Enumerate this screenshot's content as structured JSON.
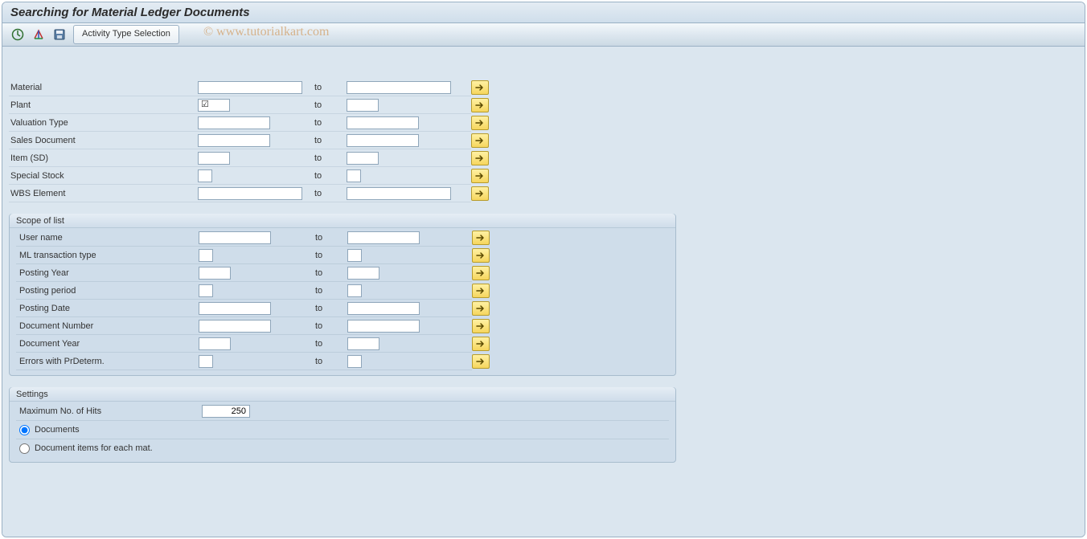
{
  "title": "Searching for Material Ledger Documents",
  "toolbar": {
    "activity_btn": "Activity Type Selection"
  },
  "watermark": "© www.tutorialkart.com",
  "to_label": "to",
  "top_fields": [
    {
      "label": "Material",
      "from_w": "lg",
      "to_w": "lg",
      "check": false
    },
    {
      "label": "Plant",
      "from_w": "sm",
      "to_w": "sm",
      "check": true
    },
    {
      "label": "Valuation Type",
      "from_w": "md",
      "to_w": "md",
      "check": false
    },
    {
      "label": "Sales Document",
      "from_w": "md",
      "to_w": "md",
      "check": false
    },
    {
      "label": "Item (SD)",
      "from_w": "sm",
      "to_w": "sm",
      "check": false
    },
    {
      "label": "Special Stock",
      "from_w": "xs",
      "to_w": "xs",
      "check": false
    },
    {
      "label": "WBS Element",
      "from_w": "lg",
      "to_w": "lg",
      "check": false
    }
  ],
  "scope": {
    "legend": "Scope of list",
    "fields": [
      {
        "label": "User name",
        "from_w": "md",
        "to_w": "md"
      },
      {
        "label": "ML transaction type",
        "from_w": "xs",
        "to_w": "xs"
      },
      {
        "label": "Posting Year",
        "from_w": "sm",
        "to_w": "sm"
      },
      {
        "label": "Posting period",
        "from_w": "xs",
        "to_w": "xs"
      },
      {
        "label": "Posting Date",
        "from_w": "md",
        "to_w": "md"
      },
      {
        "label": "Document Number",
        "from_w": "md",
        "to_w": "md"
      },
      {
        "label": "Document Year",
        "from_w": "sm",
        "to_w": "sm"
      },
      {
        "label": "Errors with PrDeterm.",
        "from_w": "xs",
        "to_w": "xs"
      }
    ]
  },
  "settings": {
    "legend": "Settings",
    "max_hits_label": "Maximum No. of Hits",
    "max_hits_value": "250",
    "radio_documents": "Documents",
    "radio_items": "Document items for each mat."
  }
}
